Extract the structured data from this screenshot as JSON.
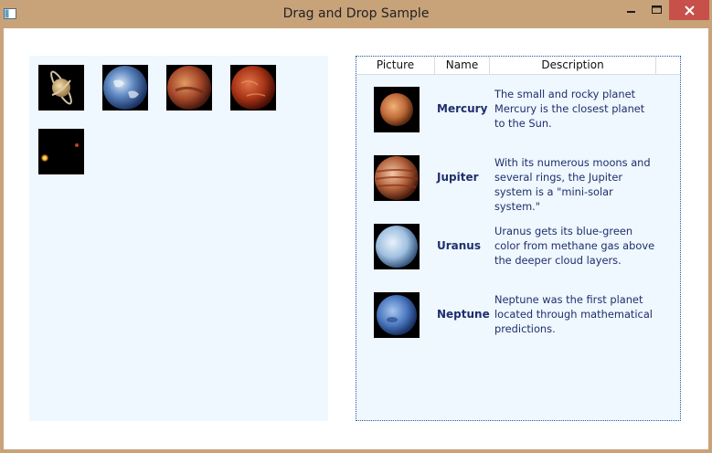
{
  "window": {
    "title": "Drag and Drop Sample",
    "colors": {
      "frame": "#c8a37a",
      "close": "#c7504a",
      "panel": "#eff7ff",
      "text": "#1f2f6b"
    }
  },
  "palette": {
    "items": [
      {
        "name": "saturn-icon"
      },
      {
        "name": "earth-icon"
      },
      {
        "name": "mars-icon"
      },
      {
        "name": "venus-icon"
      },
      {
        "name": "sun-icon"
      }
    ]
  },
  "list": {
    "columns": [
      "Picture",
      "Name",
      "Description"
    ],
    "rows": [
      {
        "icon": "mercury-icon",
        "name": "Mercury",
        "description": "The small and rocky planet Mercury is the closest planet to the Sun."
      },
      {
        "icon": "jupiter-icon",
        "name": "Jupiter",
        "description": "With its numerous moons and several rings, the Jupiter system is a \"mini-solar system.\""
      },
      {
        "icon": "uranus-icon",
        "name": "Uranus",
        "description": "Uranus gets its blue-green color from methane gas above the deeper cloud layers."
      },
      {
        "icon": "neptune-icon",
        "name": "Neptune",
        "description": "Neptune was the first planet located through mathematical predictions."
      }
    ]
  }
}
